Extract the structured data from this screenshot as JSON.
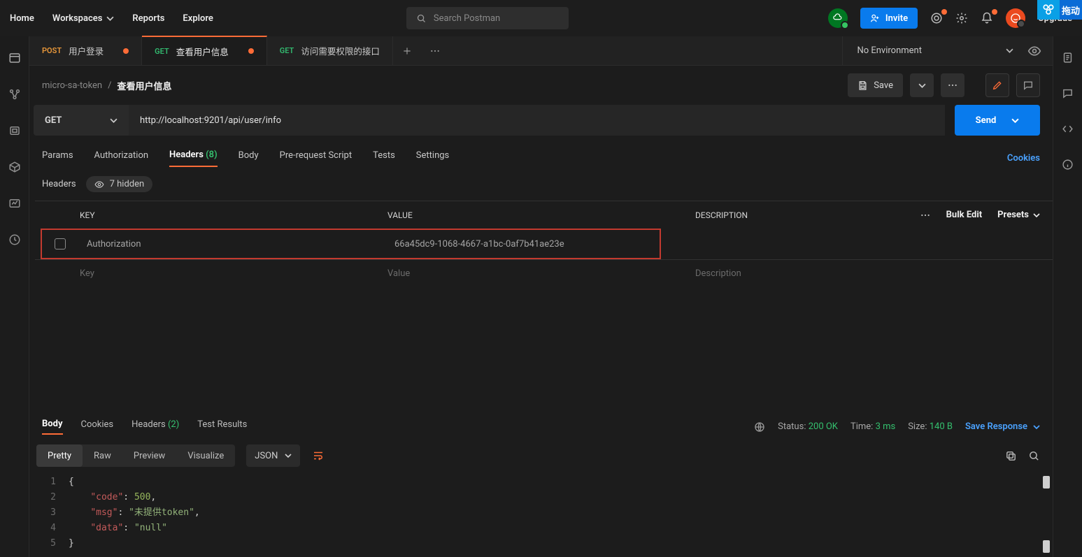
{
  "topnav": {
    "home": "Home",
    "workspaces": "Workspaces",
    "reports": "Reports",
    "explore": "Explore",
    "search_placeholder": "Search Postman",
    "invite": "Invite",
    "upgrade": "Upgrade"
  },
  "corner": {
    "c2": "拖动"
  },
  "tabs": [
    {
      "method": "POST",
      "title": "用户登录",
      "unsaved": true
    },
    {
      "method": "GET",
      "title": "查看用户信息",
      "unsaved": true,
      "active": true
    },
    {
      "method": "GET",
      "title": "访问需要权限的接口",
      "unsaved": false
    }
  ],
  "env": {
    "label": "No Environment"
  },
  "breadcrumb": {
    "collection": "micro-sa-token",
    "current": "查看用户信息",
    "save": "Save"
  },
  "request": {
    "method": "GET",
    "url": "http://localhost:9201/api/user/info",
    "send": "Send"
  },
  "reqTabs": {
    "params": "Params",
    "auth": "Authorization",
    "headers": "Headers",
    "headers_count": "(8)",
    "body": "Body",
    "pre": "Pre-request Script",
    "tests": "Tests",
    "settings": "Settings",
    "cookies": "Cookies"
  },
  "headersSub": {
    "label": "Headers",
    "hidden": "7 hidden"
  },
  "htable": {
    "cols": {
      "key": "KEY",
      "value": "VALUE",
      "desc": "DESCRIPTION"
    },
    "bulk": "Bulk Edit",
    "presets": "Presets",
    "row": {
      "key": "Authorization",
      "value": "66a45dc9-1068-4667-a1bc-0af7b41ae23e"
    },
    "placeholders": {
      "key": "Key",
      "value": "Value",
      "desc": "Description"
    }
  },
  "respTabs": {
    "body": "Body",
    "cookies": "Cookies",
    "headers": "Headers",
    "headers_count": "(2)",
    "test": "Test Results"
  },
  "respMeta": {
    "status_label": "Status:",
    "status_val": "200 OK",
    "time_label": "Time:",
    "time_val": "3 ms",
    "size_label": "Size:",
    "size_val": "140 B",
    "save": "Save Response"
  },
  "viewRow": {
    "pretty": "Pretty",
    "raw": "Raw",
    "preview": "Preview",
    "visualize": "Visualize",
    "lang": "JSON"
  },
  "responseBody": {
    "code": 500,
    "msg": "未提供token",
    "data": "null"
  },
  "code": {
    "l1": "{",
    "l2a": "\"code\"",
    "l2b": ": ",
    "l2c": "500",
    "l2d": ",",
    "l3a": "\"msg\"",
    "l3b": ": ",
    "l3c": "\"未提供token\"",
    "l3d": ",",
    "l4a": "\"data\"",
    "l4b": ": ",
    "l4c": "\"null\"",
    "l5": "}"
  }
}
